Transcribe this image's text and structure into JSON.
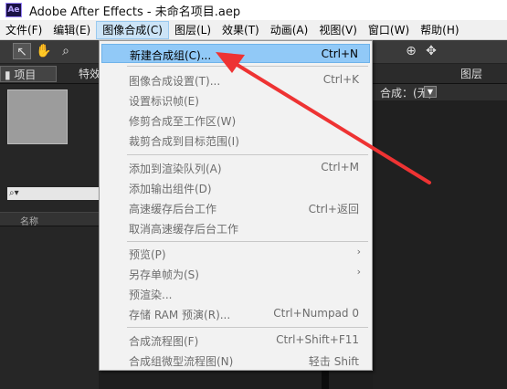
{
  "window": {
    "app_icon": "Ae",
    "title": "Adobe After Effects - 未命名项目.aep"
  },
  "menubar": [
    "文件(F)",
    "编辑(E)",
    "图像合成(C)",
    "图层(L)",
    "效果(T)",
    "动画(A)",
    "视图(V)",
    "窗口(W)",
    "帮助(H)"
  ],
  "panels": {
    "project_tab": "项目",
    "effects_tab": "特效",
    "column_name": "名称",
    "composition_label": "合成：(无)",
    "layer_label": "图层"
  },
  "dropdown": {
    "items": [
      {
        "label": "新建合成组(C)...",
        "shortcut": "Ctrl+N",
        "highlight": true,
        "enabled": true
      },
      {
        "label": "图像合成设置(T)...",
        "shortcut": "Ctrl+K",
        "enabled": false
      },
      {
        "label": "设置标识帧(E)",
        "shortcut": "",
        "enabled": false
      },
      {
        "label": "修剪合成至工作区(W)",
        "shortcut": "",
        "enabled": false
      },
      {
        "label": "裁剪合成到目标范围(I)",
        "shortcut": "",
        "enabled": false
      },
      {
        "label": "添加到渲染队列(A)",
        "shortcut": "Ctrl+M",
        "enabled": false
      },
      {
        "label": "添加输出组件(D)",
        "shortcut": "",
        "enabled": false
      },
      {
        "label": "高速缓存后台工作",
        "shortcut": "Ctrl+返回",
        "enabled": false
      },
      {
        "label": "取消高速缓存后台工作",
        "shortcut": "",
        "enabled": false
      },
      {
        "label": "预览(P)",
        "shortcut": "",
        "submenu": true,
        "enabled": false
      },
      {
        "label": "另存单帧为(S)",
        "shortcut": "",
        "submenu": true,
        "enabled": false
      },
      {
        "label": "预渲染...",
        "shortcut": "",
        "enabled": false
      },
      {
        "label": "存储 RAM 预演(R)...",
        "shortcut": "Ctrl+Numpad 0",
        "enabled": false
      },
      {
        "label": "合成流程图(F)",
        "shortcut": "Ctrl+Shift+F11",
        "enabled": false
      },
      {
        "label": "合成组微型流程图(N)",
        "shortcut": "轻击 Shift",
        "enabled": false
      }
    ]
  },
  "colors": {
    "annotation_arrow": "#ee3333",
    "highlight": "#91c9f7"
  }
}
